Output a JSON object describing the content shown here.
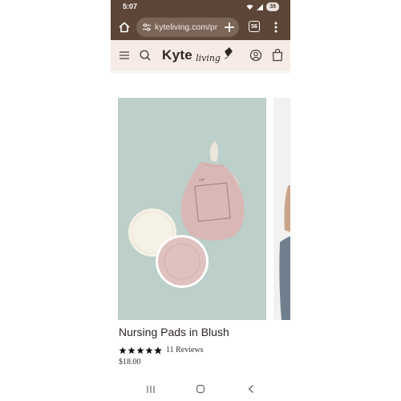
{
  "status_bar": {
    "time": "5:07",
    "battery": "38"
  },
  "browser": {
    "url": "kyteliving.com/pr",
    "tab_count": "56"
  },
  "site_header": {
    "logo_main": "Kyte",
    "logo_script": "living"
  },
  "product": {
    "title": "Nursing Pads in Blush",
    "rating_stars": 4.5,
    "reviews": "11 Reviews",
    "price": "$18.00"
  },
  "colors": {
    "browser_chrome": "#5d4637",
    "site_header_bg": "#f6ece5",
    "image_bg": "#bccfca",
    "blush": "#e2c4c1"
  }
}
